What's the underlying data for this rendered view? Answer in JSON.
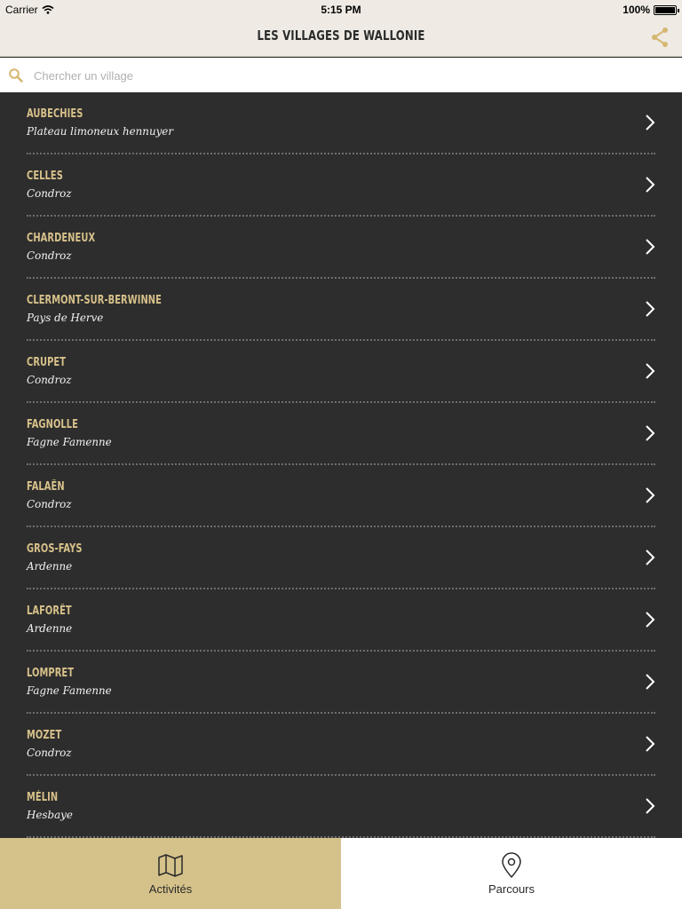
{
  "status_bar": {
    "carrier": "Carrier",
    "time": "5:15 PM",
    "battery": "100%"
  },
  "nav": {
    "title": "LES VILLAGES DE WALLONIE",
    "share_icon": "share-icon"
  },
  "search": {
    "placeholder": "Chercher un village",
    "value": ""
  },
  "villages": [
    {
      "name": "AUBECHIES",
      "region": "Plateau limoneux hennuyer"
    },
    {
      "name": "CELLES",
      "region": "Condroz"
    },
    {
      "name": "CHARDENEUX",
      "region": "Condroz"
    },
    {
      "name": "CLERMONT-SUR-BERWINNE",
      "region": "Pays de Herve"
    },
    {
      "name": "CRUPET",
      "region": "Condroz"
    },
    {
      "name": "FAGNOLLE",
      "region": "Fagne Famenne"
    },
    {
      "name": "FALAËN",
      "region": "Condroz"
    },
    {
      "name": "GROS-FAYS",
      "region": "Ardenne"
    },
    {
      "name": "LAFORÊT",
      "region": "Ardenne"
    },
    {
      "name": "LOMPRET",
      "region": "Fagne Famenne"
    },
    {
      "name": "MOZET",
      "region": "Condroz"
    },
    {
      "name": "MÉLIN",
      "region": "Hesbaye"
    }
  ],
  "tabs": [
    {
      "label": "Activités",
      "icon": "map-icon",
      "active": true
    },
    {
      "label": "Parcours",
      "icon": "location-pin-icon",
      "active": false
    }
  ],
  "colors": {
    "accent": "#d5c28a",
    "list_background": "#2d2d2d",
    "village_name": "#d7c18a",
    "nav_background": "#efebe4"
  }
}
